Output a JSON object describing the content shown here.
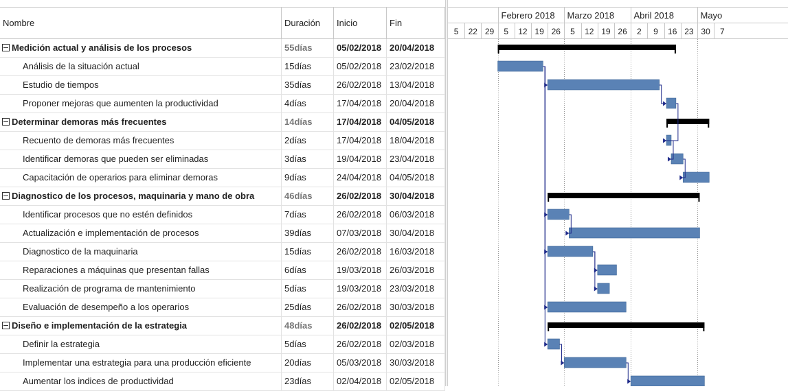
{
  "headers": {
    "name": "Nombre",
    "duration": "Duración",
    "start": "Inicio",
    "end": "Fin"
  },
  "tasks": [
    {
      "name": "Medición actual y análisis de los procesos",
      "duration": "55días",
      "start": "05/02/2018",
      "end": "20/04/2018",
      "summary": true
    },
    {
      "name": "Análisis de la situación actual",
      "duration": "15días",
      "start": "05/02/2018",
      "end": "23/02/2018",
      "summary": false
    },
    {
      "name": "Estudio de tiempos",
      "duration": "35días",
      "start": "26/02/2018",
      "end": "13/04/2018",
      "summary": false
    },
    {
      "name": "Proponer mejoras que aumenten la productividad",
      "duration": "4días",
      "start": "17/04/2018",
      "end": "20/04/2018",
      "summary": false
    },
    {
      "name": "Determinar demoras más frecuentes",
      "duration": "14días",
      "start": "17/04/2018",
      "end": "04/05/2018",
      "summary": true
    },
    {
      "name": "Recuento de demoras más frecuentes",
      "duration": "2días",
      "start": "17/04/2018",
      "end": "18/04/2018",
      "summary": false
    },
    {
      "name": "Identificar demoras que pueden ser eliminadas",
      "duration": "3días",
      "start": "19/04/2018",
      "end": "23/04/2018",
      "summary": false
    },
    {
      "name": "Capacitación de operarios para eliminar demoras",
      "duration": "9días",
      "start": "24/04/2018",
      "end": "04/05/2018",
      "summary": false
    },
    {
      "name": "Diagnostico de los procesos, maquinaria y mano de obra",
      "duration": "46días",
      "start": "26/02/2018",
      "end": "30/04/2018",
      "summary": true
    },
    {
      "name": "Identificar procesos que no estén definidos",
      "duration": "7días",
      "start": "26/02/2018",
      "end": "06/03/2018",
      "summary": false
    },
    {
      "name": "Actualización e implementación de procesos",
      "duration": "39días",
      "start": "07/03/2018",
      "end": "30/04/2018",
      "summary": false
    },
    {
      "name": "Diagnostico de la maquinaria",
      "duration": "15días",
      "start": "26/02/2018",
      "end": "16/03/2018",
      "summary": false
    },
    {
      "name": "Reparaciones a máquinas que presentan fallas",
      "duration": "6días",
      "start": "19/03/2018",
      "end": "26/03/2018",
      "summary": false
    },
    {
      "name": "Realización de programa de mantenimiento",
      "duration": "5días",
      "start": "19/03/2018",
      "end": "23/03/2018",
      "summary": false
    },
    {
      "name": "Evaluación de desempeño a los operarios",
      "duration": "25días",
      "start": "26/02/2018",
      "end": "30/03/2018",
      "summary": false
    },
    {
      "name": "Diseño e implementación de la estrategia",
      "duration": "48días",
      "start": "26/02/2018",
      "end": "02/05/2018",
      "summary": true
    },
    {
      "name": "Definir la estrategia",
      "duration": "5días",
      "start": "26/02/2018",
      "end": "02/03/2018",
      "summary": false
    },
    {
      "name": "Implementar una estrategia para una producción eficiente",
      "duration": "20días",
      "start": "05/03/2018",
      "end": "30/03/2018",
      "summary": false
    },
    {
      "name": "Aumentar los indices de productividad",
      "duration": "23días",
      "start": "02/04/2018",
      "end": "02/05/2018",
      "summary": false
    }
  ],
  "timeline": {
    "months": [
      "Febrero 2018",
      "Marzo 2018",
      "Abril 2018",
      "Mayo"
    ],
    "weeks": [
      "5",
      "22",
      "29",
      "5",
      "12",
      "19",
      "26",
      "5",
      "12",
      "19",
      "26",
      "2",
      "9",
      "16",
      "23",
      "30",
      "7"
    ],
    "week_start_dates": [
      "2018-01-15",
      "2018-01-22",
      "2018-01-29",
      "2018-02-05",
      "2018-02-12",
      "2018-02-19",
      "2018-02-26",
      "2018-03-05",
      "2018-03-12",
      "2018-03-19",
      "2018-03-26",
      "2018-04-02",
      "2018-04-09",
      "2018-04-16",
      "2018-04-23",
      "2018-04-30",
      "2018-05-07"
    ]
  },
  "dependencies": [
    [
      1,
      2
    ],
    [
      2,
      3
    ],
    [
      3,
      5
    ],
    [
      5,
      6
    ],
    [
      6,
      7
    ],
    [
      1,
      9
    ],
    [
      9,
      10
    ],
    [
      1,
      11
    ],
    [
      11,
      12
    ],
    [
      11,
      13
    ],
    [
      1,
      14
    ],
    [
      1,
      16
    ],
    [
      16,
      17
    ],
    [
      17,
      18
    ]
  ],
  "colors": {
    "task_bar": "#5a82b5",
    "summary_bar": "#000000",
    "link": "#1f2a8a",
    "grid": "#e2e2e2"
  }
}
